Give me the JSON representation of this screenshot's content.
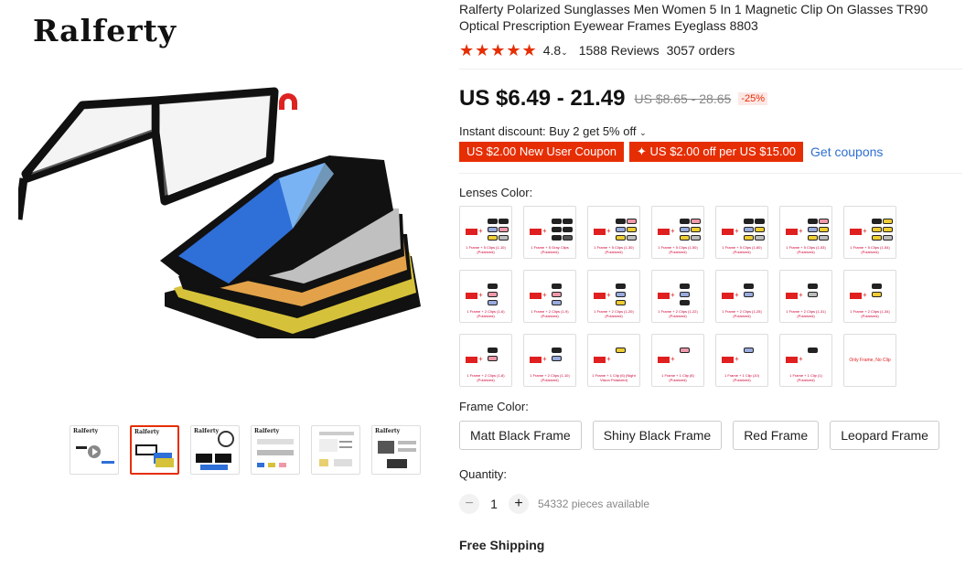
{
  "brand": "Ralferty",
  "product": {
    "title": "Ralferty Polarized Sunglasses Men Women 5 In 1 Magnetic Clip On Glasses TR90 Optical Prescription Eyewear Frames Eyeglass 8803",
    "rating": "4.8",
    "reviews": "1588 Reviews",
    "orders": "3057 orders",
    "price": "US $6.49 - 21.49",
    "old_price": "US $8.65 - 28.65",
    "discount": "-25%",
    "instant_discount": "Instant discount: Buy 2 get 5% off",
    "coupons": [
      "US $2.00 New User Coupon",
      "✦ US $2.00 off per US $15.00"
    ],
    "get_coupons": "Get coupons"
  },
  "lenses": {
    "label": "Lenses Color:",
    "items": [
      {
        "clips": [
          "#222",
          "#222",
          "#9ad",
          "#e9a",
          "#ec3",
          "#bbb"
        ],
        "cap": "1 Frame + 5 Clips (1-10) (Polarized)"
      },
      {
        "clips": [
          "#222",
          "#222",
          "#222",
          "#222",
          "#222",
          "#555"
        ],
        "cap": "1 Frame + 5 Gray Clips (Polarized)"
      },
      {
        "clips": [
          "#222",
          "#e9a",
          "#9ad",
          "#ec3",
          "#ec3",
          "#bbb"
        ],
        "cap": "1 Frame + 5 Clips (1-30) (Polarized)"
      },
      {
        "clips": [
          "#222",
          "#e9a",
          "#9ad",
          "#ec3",
          "#ec3",
          "#bbb"
        ],
        "cap": "1 Frame + 5 Clips (1-50) (Polarized)"
      },
      {
        "clips": [
          "#222",
          "#222",
          "#9ad",
          "#ec3",
          "#ec3",
          "#bbb"
        ],
        "cap": "1 Frame + 5 Clips (1-60) (Polarized)"
      },
      {
        "clips": [
          "#222",
          "#e9a",
          "#9ad",
          "#ec3",
          "#ec3",
          "#bbb"
        ],
        "cap": "1 Frame + 5 Clips (1-53) (Polarized)"
      },
      {
        "clips": [
          "#222",
          "#ec3",
          "#ec3",
          "#ec3",
          "#ec3",
          "#bbb"
        ],
        "cap": "1 Frame + 5 Clips (1-54) (Polarized)"
      },
      {
        "clips": [
          "#222",
          "#e9a",
          "#9ad"
        ],
        "cap": "1 Frame + 2 Clips (1-6) (Polarized)"
      },
      {
        "clips": [
          "#222",
          "#e9a",
          "#9ad"
        ],
        "cap": "1 Frame + 2 Clips (1-9) (Polarized)"
      },
      {
        "clips": [
          "#222",
          "#9ad",
          "#ec3"
        ],
        "cap": "1 Frame + 2 Clips (1-20) (Polarized)"
      },
      {
        "clips": [
          "#222",
          "#9ad",
          "#222"
        ],
        "cap": "1 Frame + 2 Clips (1-22) (Polarized)"
      },
      {
        "clips": [
          "#222",
          "#9ad"
        ],
        "cap": "1 Frame + 2 Clips (1-25) (Polarized)"
      },
      {
        "clips": [
          "#222",
          "#bbb"
        ],
        "cap": "1 Frame + 2 Clips (1-31) (Polarized)"
      },
      {
        "clips": [
          "#222",
          "#ec3"
        ],
        "cap": "1 Frame + 2 Clips (1-34) (Polarized)"
      },
      {
        "clips": [
          "#222",
          "#e9a"
        ],
        "cap": "1 Frame + 2 Clips (1-8) (Polarized)"
      },
      {
        "clips": [
          "#222",
          "#9ad"
        ],
        "cap": "1 Frame + 2 Clips (1-10) (Polarized)"
      },
      {
        "clips": [
          "#ec3"
        ],
        "cap": "1 Frame + 1 Clip (6) (Night Vision Polarized)"
      },
      {
        "clips": [
          "#e9a"
        ],
        "cap": "1 Frame + 1 Clip (8) (Polarized)"
      },
      {
        "clips": [
          "#9ad"
        ],
        "cap": "1 Frame + 1 Clip (10) (Polarized)"
      },
      {
        "clips": [
          "#222"
        ],
        "cap": "1 Frame + 1 Clip (1) (Polarized)"
      },
      {
        "clips": [],
        "cap": "",
        "only": "Only Frame, No Clip"
      }
    ]
  },
  "frame": {
    "label": "Frame Color:",
    "options": [
      "Matt Black Frame",
      "Shiny Black Frame",
      "Red Frame",
      "Leopard Frame"
    ]
  },
  "quantity": {
    "label": "Quantity:",
    "minus": "−",
    "value": "1",
    "plus": "+",
    "available": "54332 pieces available"
  },
  "shipping": "Free Shipping",
  "colors": {
    "accent": "#e62e04",
    "link": "#2e6fd1"
  }
}
